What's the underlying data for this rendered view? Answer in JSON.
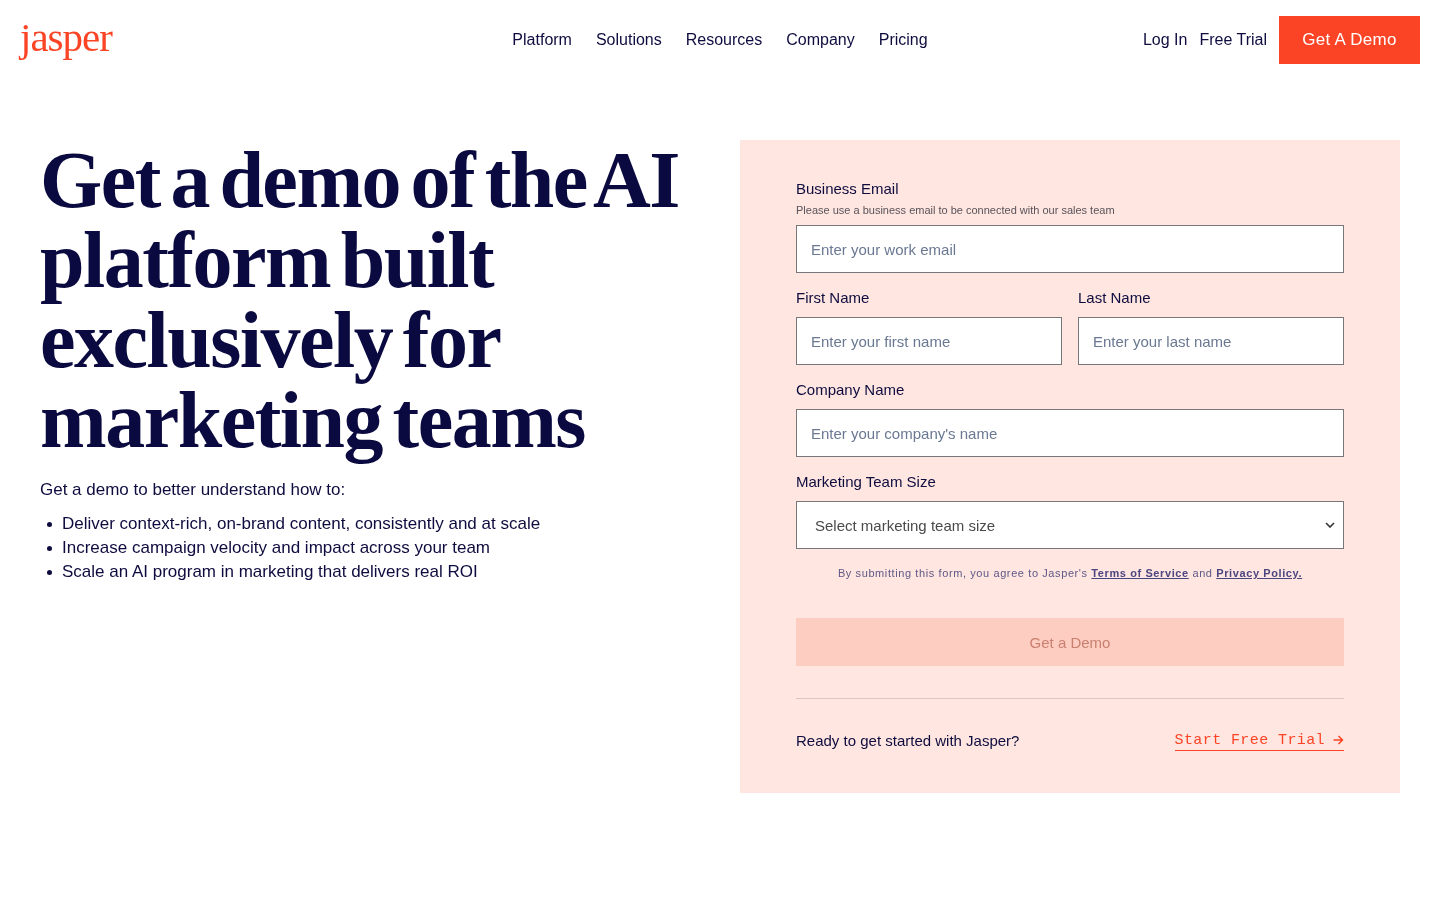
{
  "header": {
    "logo": "jasper",
    "nav": [
      {
        "label": "Platform"
      },
      {
        "label": "Solutions"
      },
      {
        "label": "Resources"
      },
      {
        "label": "Company"
      },
      {
        "label": "Pricing"
      }
    ],
    "actions": {
      "login": "Log In",
      "trial": "Free Trial",
      "demo": "Get A Demo"
    }
  },
  "hero": {
    "heading": "Get a demo of the AI platform built exclusively for marketing teams",
    "intro": "Get a demo to better understand how to:",
    "bullets": [
      "Deliver context-rich, on-brand content, consistently and at scale",
      "Increase campaign velocity and impact across your team",
      "Scale an AI program in marketing that delivers real ROI"
    ]
  },
  "form": {
    "rows": [
      {
        "fields": [
          {
            "kind": "input",
            "label": "Business Email",
            "hint": "Please use a business email to be connected with our sales team",
            "placeholder": "Enter your work email"
          }
        ]
      },
      {
        "fields": [
          {
            "kind": "input",
            "label": "First Name",
            "placeholder": "Enter your first name"
          },
          {
            "kind": "input",
            "label": "Last Name",
            "placeholder": "Enter your last name"
          }
        ]
      },
      {
        "fields": [
          {
            "kind": "input",
            "label": "Company Name",
            "placeholder": "Enter your company's name"
          }
        ]
      },
      {
        "fields": [
          {
            "kind": "select",
            "label": "Marketing Team Size",
            "value": "Select marketing team size"
          }
        ]
      }
    ],
    "consent": [
      {
        "kind": "text",
        "text": "By submitting this form, you agree to Jasper's"
      },
      {
        "kind": "link",
        "text": "Terms of Service"
      },
      {
        "kind": "text",
        "text": "and"
      },
      {
        "kind": "link",
        "text": "Privacy Policy."
      }
    ],
    "submit": {
      "label": "Get a Demo",
      "disabled": true
    },
    "footer": {
      "text": "Ready to get started with Jasper?",
      "link": "Start Free Trial"
    }
  }
}
